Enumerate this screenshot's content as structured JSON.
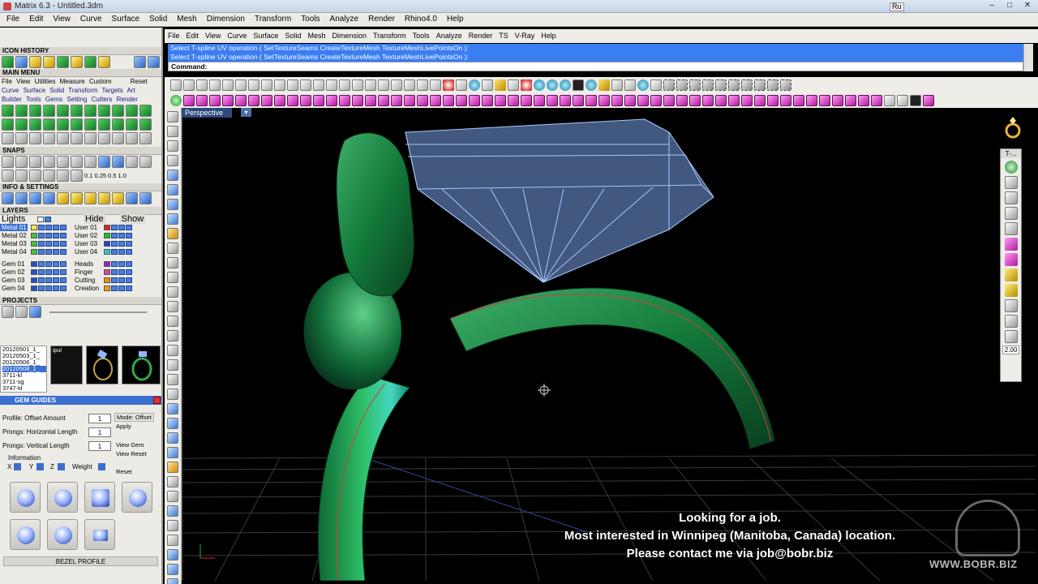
{
  "window": {
    "title": "Matrix 6.3 - Untitled.3dm",
    "lang_badge": "Ru",
    "controls": [
      "–",
      "□",
      "✕"
    ]
  },
  "matrix_menu": [
    "File",
    "Edit",
    "View",
    "Curve",
    "Surface",
    "Solid",
    "Mesh",
    "Dimension",
    "Transform",
    "Tools",
    "Analyze",
    "Render",
    "Rhino4.0",
    "Help"
  ],
  "left_panel": {
    "icon_history": "ICON HISTORY",
    "main_menu": "MAIN MENU",
    "main_menu_tabs": [
      "File",
      "View",
      "Utilities",
      "Measure",
      "Custom",
      "Reset"
    ],
    "module_row1": [
      "Curve",
      "Surface",
      "Solid",
      "Transform",
      "Targets",
      "Art"
    ],
    "module_row2": [
      "Builder",
      "Tools",
      "Gems",
      "Setting",
      "Cutters",
      "Render"
    ],
    "snaps": "SNAPS",
    "snap_values": [
      "0.1",
      "0.25",
      "0.5",
      "1.0"
    ],
    "info_settings": "INFO & SETTINGS",
    "layers": "LAYERS",
    "layers_hide": "Hide",
    "layers_show": "Show",
    "lights": "Lights",
    "layers_left": [
      {
        "name": "Metal 01",
        "color": "#ffe24a",
        "selected": true
      },
      {
        "name": "Metal 02",
        "color": "#43c443"
      },
      {
        "name": "Metal 03",
        "color": "#43c443"
      },
      {
        "name": "Metal 04",
        "color": "#43c443"
      },
      {
        "name": "Gem 01",
        "color": "#1f4fd0"
      },
      {
        "name": "Gem 02",
        "color": "#1f4fd0"
      },
      {
        "name": "Gem 03",
        "color": "#1f4fd0"
      },
      {
        "name": "Gem 04",
        "color": "#1f4fd0"
      }
    ],
    "layers_right": [
      {
        "name": "User 01",
        "color": "#e02020"
      },
      {
        "name": "User 02",
        "color": "#20c020"
      },
      {
        "name": "User 03",
        "color": "#2040e0"
      },
      {
        "name": "User 04",
        "color": "#20d0d0"
      },
      {
        "name": "Heads",
        "color": "#a020c0"
      },
      {
        "name": "Finger",
        "color": "#e040a0"
      },
      {
        "name": "Cutting",
        "color": "#ff8c00"
      },
      {
        "name": "Creation",
        "color": "#ff9c00"
      }
    ],
    "projects": "PROJECTS",
    "project_items": [
      "20120501_1_",
      "20120503_1_",
      "20120506_1_",
      "20120508_1_",
      "3711-kl",
      "3711-sg",
      "3747-kl"
    ],
    "project_thumb_label": "ipul",
    "gem_guides": "GEM GUIDES",
    "profile_offset_label": "Profile:  Offset Amount",
    "profile_offset_value": "1",
    "mode_label": "Mode: Offset",
    "apply_label": "Apply",
    "prongs_h_label": "Prongs:  Horizontal Length",
    "prongs_h_value": "1",
    "prongs_v_label": "Prongs:  Vertical Length",
    "prongs_v_value": "1",
    "view_gem": "View Gem",
    "view_reset": "View Reset",
    "information": "Information",
    "info_x": "X",
    "info_y": "Y",
    "info_z": "Z",
    "weight": "Weight",
    "reset": "Reset",
    "bezel_profile": "BEZEL PROFILE"
  },
  "rhino_menu": [
    "File",
    "Edit",
    "View",
    "Curve",
    "Surface",
    "Solid",
    "Mesh",
    "Dimension",
    "Transform",
    "Tools",
    "Analyze",
    "Render",
    "TS",
    "V-Ray",
    "Help"
  ],
  "command": {
    "history": [
      "Select T-spline UV operation ( SetTextureSeams  CreateTextureMesh  TextureMeshLivePointsOn ):",
      "Select T-spline UV operation ( SetTextureSeams  CreateTextureMesh  TextureMeshLivePointsOn ):"
    ],
    "prompt": "Command:"
  },
  "viewport": {
    "tab": "Perspective"
  },
  "right_toolbar": {
    "header": "T-...",
    "value": "2.00"
  },
  "overlay": [
    "Looking for a job.",
    "Most interested in Winnipeg (Manitoba, Canada) location.",
    "Please contact me via  job@bobr.biz"
  ],
  "watermark": "WWW.BOBR.BIZ",
  "colors": {
    "command_bg": "#3a7ef2",
    "metal": "#137a3a",
    "gem_wire": "#8fb7ff",
    "viewport_bg": "#000000"
  }
}
